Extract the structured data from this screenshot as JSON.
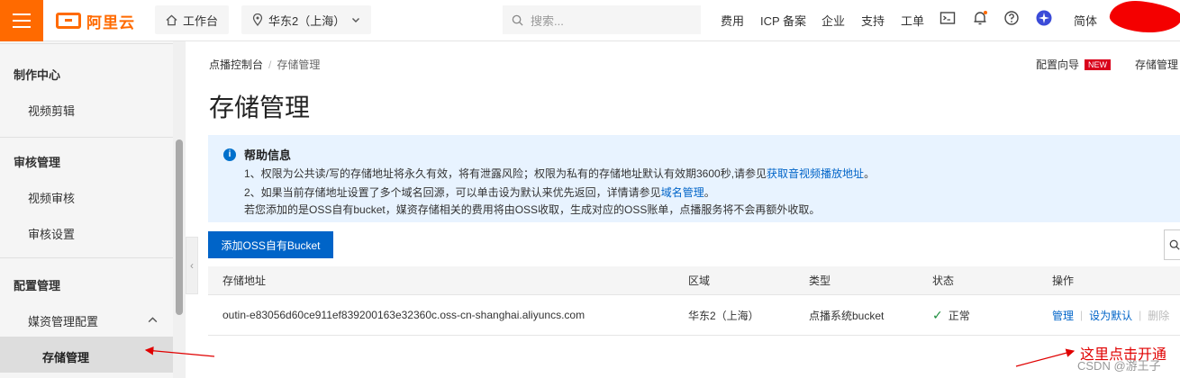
{
  "header": {
    "logo_text": "阿里云",
    "workbench": "工作台",
    "region": "华东2（上海）",
    "search_placeholder": "搜索...",
    "nav": [
      "费用",
      "ICP 备案",
      "企业",
      "支持",
      "工单"
    ],
    "language": "简体",
    "brand_color": "#ff6a00"
  },
  "sidebar": {
    "groups": [
      {
        "label": "制作中心",
        "items": [
          "视频剪辑"
        ]
      },
      {
        "label": "审核管理",
        "items": [
          "视频审核",
          "审核设置"
        ]
      },
      {
        "label": "配置管理",
        "items": [
          "媒资管理配置",
          "存储管理"
        ]
      }
    ],
    "active_item": "存储管理"
  },
  "breadcrumb": [
    "点播控制台",
    "存储管理"
  ],
  "actions": {
    "guide": "配置向导",
    "new_badge": "NEW",
    "storage_link": "存储管理"
  },
  "page_title": "存储管理",
  "help": {
    "title": "帮助信息",
    "line1_prefix": "1、权限为公共读/写的存储地址将永久有效，将有泄露风险；权限为私有的存储地址默认有效期3600秒,请参见",
    "line1_link": "获取音视频播放地址",
    "line1_suffix": "。",
    "line2_prefix": "2、如果当前存储地址设置了多个域名回源，可以单击设为默认来优先返回，详情请参见",
    "line2_link": "域名管理",
    "line2_suffix": "。",
    "line3": "若您添加的是OSS自有bucket，媒资存储相关的费用将由OSS收取，生成对应的OSS账单，点播服务将不会再额外收取。"
  },
  "add_button": "添加OSS自有Bucket",
  "table": {
    "headers": [
      "存储地址",
      "区域",
      "类型",
      "状态",
      "操作"
    ],
    "rows": [
      {
        "address": "outin-e83056d60ce911ef839200163e32360c.oss-cn-shanghai.aliyuncs.com",
        "region": "华东2（上海）",
        "type": "点播系统bucket",
        "status": "正常",
        "ops": [
          "管理",
          "设为默认",
          "删除"
        ]
      }
    ]
  },
  "annotation": "这里点击开通",
  "watermark": "CSDN @游王子"
}
